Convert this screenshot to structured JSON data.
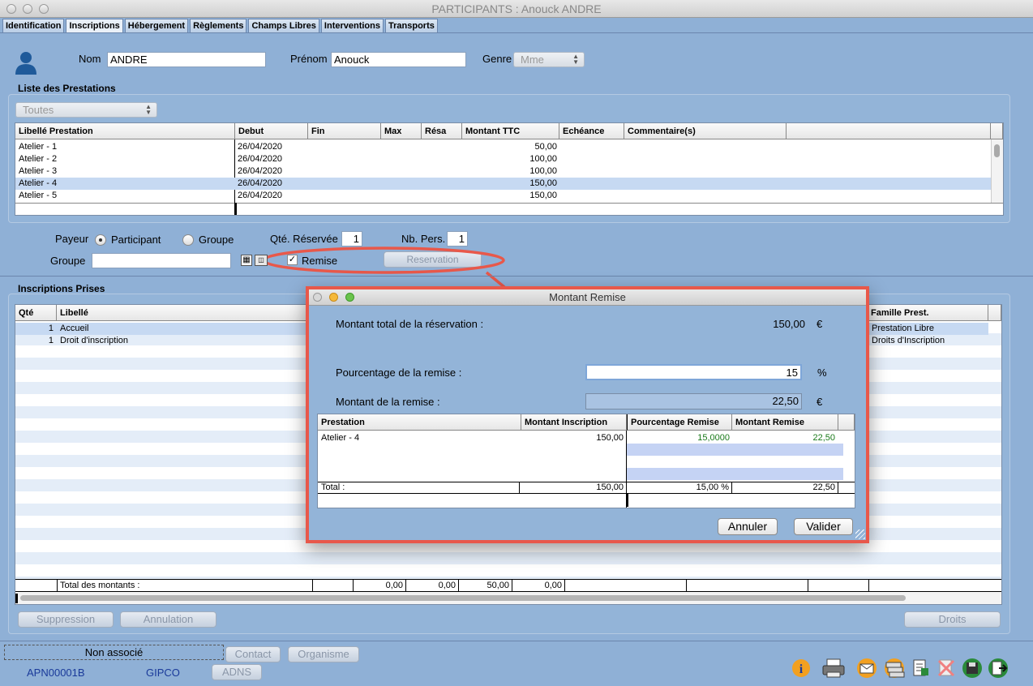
{
  "window": {
    "title": "PARTICIPANTS : Anouck ANDRE"
  },
  "tabs": [
    "Identification",
    "Inscriptions",
    "Hébergement",
    "Règlements",
    "Champs Libres",
    "Interventions",
    "Transports"
  ],
  "person": {
    "nom_label": "Nom",
    "nom_value": "ANDRE",
    "prenom_label": "Prénom",
    "prenom_value": "Anouck",
    "genre_label": "Genre",
    "genre_value": "Mme"
  },
  "prestations": {
    "title": "Liste des Prestations",
    "filter": "Toutes",
    "columns": [
      "Libellé Prestation",
      "Debut",
      "Fin",
      "Max",
      "Résa",
      "Montant TTC",
      "Echéance",
      "Commentaire(s)"
    ],
    "rows": [
      {
        "libelle": "Atelier - 1",
        "debut": "26/04/2020",
        "montant": "50,00"
      },
      {
        "libelle": "Atelier - 2",
        "debut": "26/04/2020",
        "montant": "100,00"
      },
      {
        "libelle": "Atelier - 3",
        "debut": "26/04/2020",
        "montant": "100,00"
      },
      {
        "libelle": "Atelier - 4",
        "debut": "26/04/2020",
        "montant": "150,00"
      },
      {
        "libelle": "Atelier - 5",
        "debut": "26/04/2020",
        "montant": "150,00"
      }
    ]
  },
  "payeur": {
    "label": "Payeur",
    "option1": "Participant",
    "option2": "Groupe",
    "qte_label": "Qté. Réservée",
    "qte_value": "1",
    "nbpers_label": "Nb. Pers.",
    "nbpers_value": "1",
    "groupe_label": "Groupe",
    "remise_label": "Remise",
    "reservation_button": "Reservation"
  },
  "inscriptions": {
    "title": "Inscriptions Prises",
    "col_qte": "Qté",
    "col_libelle": "Libellé",
    "col_famille": "Famille Prest.",
    "rows": [
      {
        "qte": "1",
        "libelle": "Accueil",
        "famille": "Prestation Libre"
      },
      {
        "qte": "1",
        "libelle": "Droit d'inscription",
        "famille": "Droits d'Inscription"
      }
    ],
    "total_label": "Total des montants :",
    "totals": [
      "0,00",
      "0,00",
      "50,00",
      "0,00"
    ]
  },
  "buttons": {
    "suppression": "Suppression",
    "annulation": "Annulation",
    "droits": "Droits",
    "contact": "Contact",
    "organisme": "Organisme",
    "adns": "ADNS"
  },
  "status": {
    "association": "Non associé",
    "code": "APN00001B",
    "org": "GIPCO"
  },
  "dialog": {
    "title": "Montant Remise",
    "total_label": "Montant total de la réservation :",
    "total_value": "150,00",
    "currency": "€",
    "pct_label": "Pourcentage de la remise :",
    "pct_value": "15",
    "pct_unit": "%",
    "montant_label": "Montant de la remise :",
    "montant_value": "22,50",
    "columns": [
      "Prestation",
      "Montant Inscription",
      "Pourcentage Remise",
      "Montant Remise"
    ],
    "row": {
      "prestation": "Atelier - 4",
      "inscription": "150,00",
      "pourcentage": "15,0000",
      "montant": "22,50"
    },
    "total_row": {
      "label": "Total :",
      "inscription": "150,00",
      "pourcentage": "15,00 %",
      "montant": "22,50"
    },
    "annuler": "Annuler",
    "valider": "Valider"
  }
}
